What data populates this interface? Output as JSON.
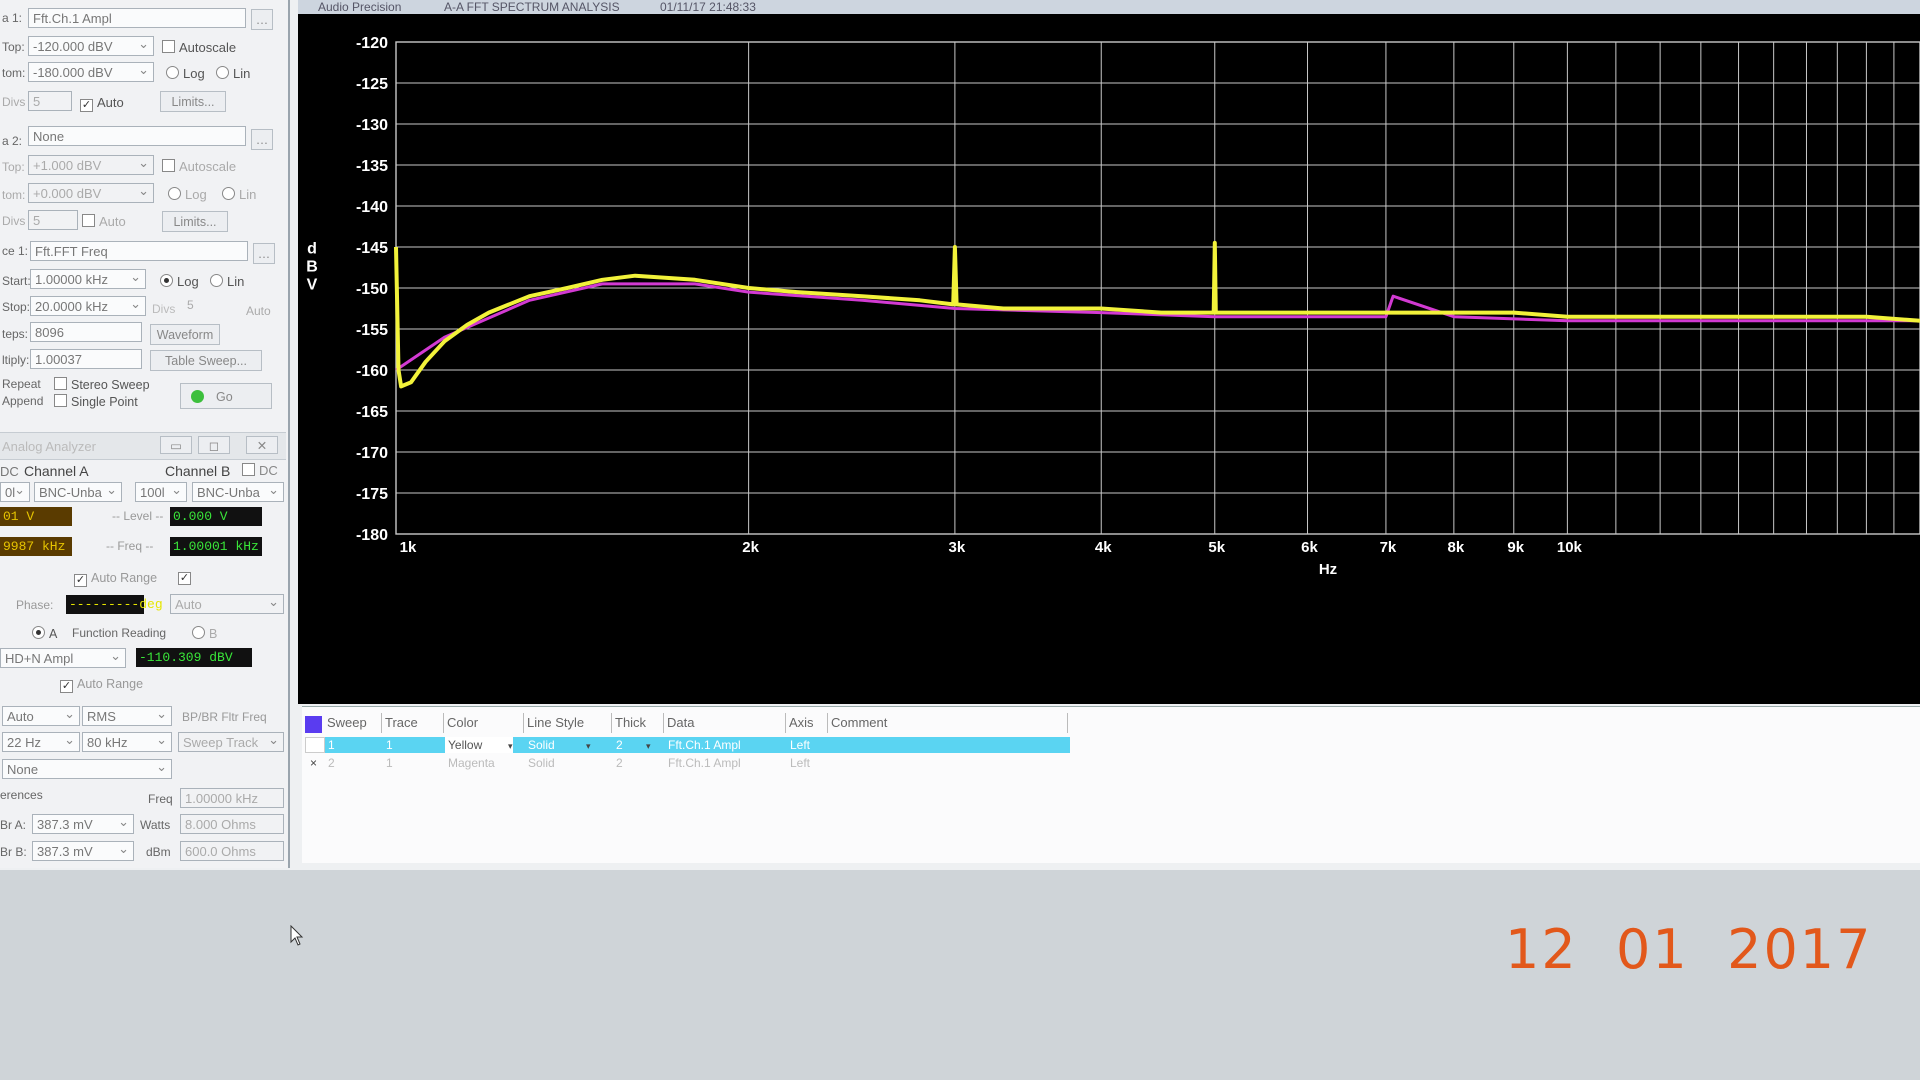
{
  "window_title": "A-A FFT SPECTRUM ANALYSIS",
  "window_timestamp": "01/11/17 21:48:33",
  "app_name": "Audio Precision",
  "left_panel": {
    "data1": {
      "label": "a 1:",
      "value": "Fft.Ch.1 Ampl",
      "top_label": "Top:",
      "top": "-120.000 dBV",
      "bottom_label": "tom:",
      "bottom": "-180.000 dBV",
      "divs_label": "Divs",
      "divs": "5",
      "autoscale": "Autoscale",
      "log": "Log",
      "lin": "Lin",
      "auto": "Auto",
      "limits": "Limits..."
    },
    "data2": {
      "label": "a 2:",
      "value": "None",
      "top_label": "Top:",
      "top": "+1.000  dBV",
      "bottom_label": "tom:",
      "bottom": "+0.000  dBV",
      "divs_label": "Divs",
      "divs": "5",
      "autoscale": "Autoscale",
      "log": "Log",
      "lin": "Lin",
      "auto": "Auto",
      "limits": "Limits..."
    },
    "source1": {
      "label": "ce 1:",
      "value": "Fft.FFT Freq",
      "start_label": "Start:",
      "start": "1.00000 kHz",
      "stop_label": "Stop:",
      "stop": "20.0000 kHz",
      "steps_label": "teps:",
      "steps": "8096",
      "multiply_label": "ltiply:",
      "multiply": "1.00037",
      "log": "Log",
      "lin": "Lin",
      "divs_label": "Divs",
      "divs": "5",
      "auto": "Auto",
      "waveform": "Waveform",
      "table_sweep": "Table Sweep..."
    },
    "repeat": "Repeat",
    "append": "Append",
    "stereo_sweep": "Stereo Sweep",
    "single_point": "Single Point",
    "go": "Go"
  },
  "analyzer": {
    "title": "Analog Analyzer",
    "dc_left": "DC",
    "channel_a": "Channel A",
    "channel_b": "Channel B",
    "dc_right": "DC",
    "coupling_a": "0l",
    "input_a": "BNC-Unba",
    "range_b": "100l",
    "input_b": "BNC-Unba",
    "level_a": "01    V",
    "level_label": "-- Level --",
    "level_b": "0.000   V",
    "freq_a": "9987 kHz",
    "freq_label": "-- Freq --",
    "freq_b": "1.00001 kHz",
    "auto_range": "Auto Range",
    "phase_label": "Phase:",
    "phase_value": "---------deg",
    "phase_mode": "Auto",
    "radio_a": "A",
    "function_reading": "Function Reading",
    "radio_b": "B",
    "function_select": "HD+N Ampl",
    "function_value": "-110.309 dBV",
    "auto_range2": "Auto Range",
    "detector_auto": "Auto",
    "detector_rms": "RMS",
    "bp_br": "BP/BR Fltr Freq",
    "hp_filter": "22 Hz",
    "lp_filter": "80 kHz",
    "sweep_track": "Sweep Track",
    "weighting": "None",
    "references": "erences",
    "freq_ref_label": "Freq",
    "freq_ref": "1.00000 kHz",
    "dbr_a_label": "Br A:",
    "dbr_a": "387.3   mV",
    "watts_label": "Watts",
    "watts": "8.000   Ohms",
    "dbr_b_label": "Br B:",
    "dbr_b": "387.3   mV",
    "dbm_label": "dBm",
    "dbm": "600.0   Ohms"
  },
  "table": {
    "headers": [
      "Sweep",
      "Trace",
      "Color",
      "Line Style",
      "Thick",
      "Data",
      "Axis",
      "Comment"
    ],
    "rows": [
      {
        "check": "",
        "sweep": "1",
        "trace": "1",
        "color": "Yellow",
        "style": "Solid",
        "thick": "2",
        "data": "Fft.Ch.1 Ampl",
        "axis": "Left",
        "comment": ""
      },
      {
        "check": "×",
        "sweep": "2",
        "trace": "1",
        "color": "Magenta",
        "style": "Solid",
        "thick": "2",
        "data": "Fft.Ch.1 Ampl",
        "axis": "Left",
        "comment": ""
      }
    ]
  },
  "datestamp": "12  01  2017",
  "colors": {
    "trace1": "#f2f23a",
    "trace2": "#d23ad2",
    "grid": "#c8c8c8",
    "background": "#000000",
    "date": "#e2581b"
  },
  "chart_data": {
    "type": "line",
    "xlabel": "Hz",
    "ylabel": "dBV",
    "x_scale": "log",
    "xlim": [
      1000,
      20000
    ],
    "ylim": [
      -180,
      -120
    ],
    "yticks": [
      -120,
      -125,
      -130,
      -135,
      -140,
      -145,
      -150,
      -155,
      -160,
      -165,
      -170,
      -175,
      -180
    ],
    "ytick_labels": [
      "-120",
      "-125",
      "-130",
      "-135",
      "-140",
      "-145",
      "-150",
      "-155",
      "-160",
      "-165",
      "-170",
      "-175",
      "-180"
    ],
    "xticks": [
      1000,
      2000,
      3000,
      4000,
      5000,
      6000,
      7000,
      8000,
      9000,
      10000
    ],
    "xtick_labels": [
      "1k",
      "2k",
      "3k",
      "4k",
      "5k",
      "6k",
      "7k",
      "8k",
      "9k",
      "10k"
    ],
    "grid": true,
    "series": [
      {
        "name": "",
        "color": "#f2f23a",
        "x": [
          1000,
          1005,
          1010,
          1030,
          1060,
          1100,
          1150,
          1200,
          1300,
          1400,
          1500,
          1600,
          1800,
          2000,
          2200,
          2500,
          2800,
          2990,
          3000,
          3010,
          3300,
          3600,
          4000,
          4500,
          4990,
          5000,
          5010,
          5500,
          6000,
          6500,
          7000,
          7500,
          8000,
          9000,
          10000,
          12000,
          14000,
          16000,
          18000,
          20000
        ],
        "y": [
          -145,
          -160,
          -162,
          -161.5,
          -159,
          -156.5,
          -154.5,
          -153,
          -151,
          -150,
          -149,
          -148.5,
          -149,
          -150,
          -150.5,
          -151,
          -151.5,
          -152,
          -145,
          -152,
          -152.5,
          -152.5,
          -152.5,
          -153,
          -153,
          -144.5,
          -153,
          -153,
          -153,
          -153,
          -153,
          -153,
          -153,
          -153,
          -153.5,
          -153.5,
          -153.5,
          -153.5,
          -153.5,
          -154
        ]
      },
      {
        "name": "",
        "color": "#d23ad2",
        "x": [
          1000,
          1100,
          1300,
          1500,
          1800,
          2000,
          2500,
          3000,
          4000,
          5000,
          6000,
          7000,
          7100,
          8000,
          10000,
          15000,
          20000
        ],
        "y": [
          -160,
          -156,
          -151.5,
          -149.5,
          -149.5,
          -150.5,
          -151.5,
          -152.5,
          -153,
          -153.5,
          -153.5,
          -153.5,
          -151,
          -153.5,
          -154,
          -154,
          -154
        ]
      }
    ]
  }
}
